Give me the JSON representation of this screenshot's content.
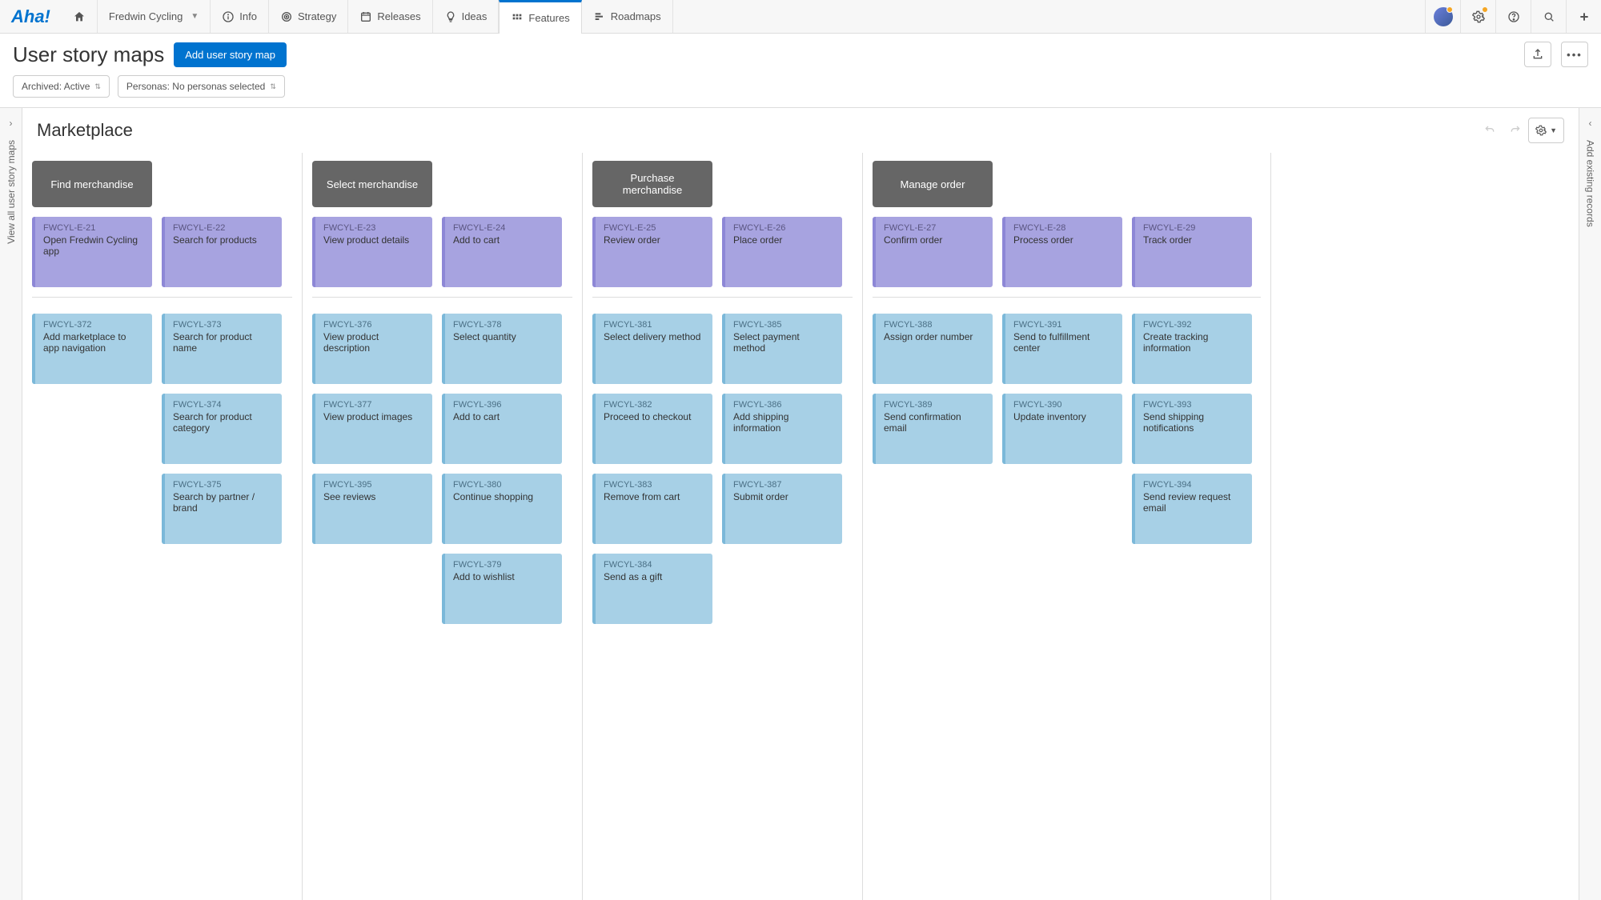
{
  "app": {
    "logo": "Aha!"
  },
  "nav": {
    "project": "Fredwin Cycling",
    "items": [
      {
        "label": "Info"
      },
      {
        "label": "Strategy"
      },
      {
        "label": "Releases"
      },
      {
        "label": "Ideas"
      },
      {
        "label": "Features",
        "active": true
      },
      {
        "label": "Roadmaps"
      }
    ]
  },
  "page": {
    "title": "User story maps",
    "add_button": "Add user story map"
  },
  "filters": {
    "archived": "Archived: Active",
    "personas": "Personas: No personas selected"
  },
  "rails": {
    "left": "View all user story maps",
    "right": "Add existing records"
  },
  "board": {
    "title": "Marketplace",
    "columns": [
      {
        "goal": "Find merchandise",
        "epics": [
          {
            "id": "FWCYL-E-21",
            "title": "Open Fredwin Cycling app"
          },
          {
            "id": "FWCYL-E-22",
            "title": "Search for products"
          }
        ],
        "story_columns": [
          [
            {
              "id": "FWCYL-372",
              "title": "Add marketplace to app navigation"
            }
          ],
          [
            {
              "id": "FWCYL-373",
              "title": "Search for product name"
            },
            {
              "id": "FWCYL-374",
              "title": "Search for product category"
            },
            {
              "id": "FWCYL-375",
              "title": "Search by partner / brand"
            }
          ]
        ]
      },
      {
        "goal": "Select merchandise",
        "epics": [
          {
            "id": "FWCYL-E-23",
            "title": "View product details"
          },
          {
            "id": "FWCYL-E-24",
            "title": "Add to cart"
          }
        ],
        "story_columns": [
          [
            {
              "id": "FWCYL-376",
              "title": "View product description"
            },
            {
              "id": "FWCYL-377",
              "title": "View product images"
            },
            {
              "id": "FWCYL-395",
              "title": "See reviews"
            }
          ],
          [
            {
              "id": "FWCYL-378",
              "title": "Select quantity"
            },
            {
              "id": "FWCYL-396",
              "title": "Add to cart"
            },
            {
              "id": "FWCYL-380",
              "title": "Continue shopping"
            },
            {
              "id": "FWCYL-379",
              "title": "Add to wishlist"
            }
          ]
        ]
      },
      {
        "goal": "Purchase merchandise",
        "epics": [
          {
            "id": "FWCYL-E-25",
            "title": "Review order"
          },
          {
            "id": "FWCYL-E-26",
            "title": "Place order"
          }
        ],
        "story_columns": [
          [
            {
              "id": "FWCYL-381",
              "title": "Select delivery method"
            },
            {
              "id": "FWCYL-382",
              "title": "Proceed to checkout"
            },
            {
              "id": "FWCYL-383",
              "title": "Remove from cart"
            },
            {
              "id": "FWCYL-384",
              "title": "Send as a gift"
            }
          ],
          [
            {
              "id": "FWCYL-385",
              "title": "Select payment method"
            },
            {
              "id": "FWCYL-386",
              "title": "Add shipping information"
            },
            {
              "id": "FWCYL-387",
              "title": "Submit order"
            }
          ]
        ]
      },
      {
        "goal": "Manage order",
        "epics": [
          {
            "id": "FWCYL-E-27",
            "title": "Confirm order"
          },
          {
            "id": "FWCYL-E-28",
            "title": "Process order"
          },
          {
            "id": "FWCYL-E-29",
            "title": "Track order"
          }
        ],
        "story_columns": [
          [
            {
              "id": "FWCYL-388",
              "title": "Assign order number"
            },
            {
              "id": "FWCYL-389",
              "title": "Send confirmation email"
            }
          ],
          [
            {
              "id": "FWCYL-391",
              "title": "Send to fulfillment center"
            },
            {
              "id": "FWCYL-390",
              "title": "Update inventory"
            }
          ],
          [
            {
              "id": "FWCYL-392",
              "title": "Create tracking information"
            },
            {
              "id": "FWCYL-393",
              "title": "Send shipping notifications"
            },
            {
              "id": "FWCYL-394",
              "title": "Send review request email"
            }
          ]
        ]
      }
    ]
  }
}
